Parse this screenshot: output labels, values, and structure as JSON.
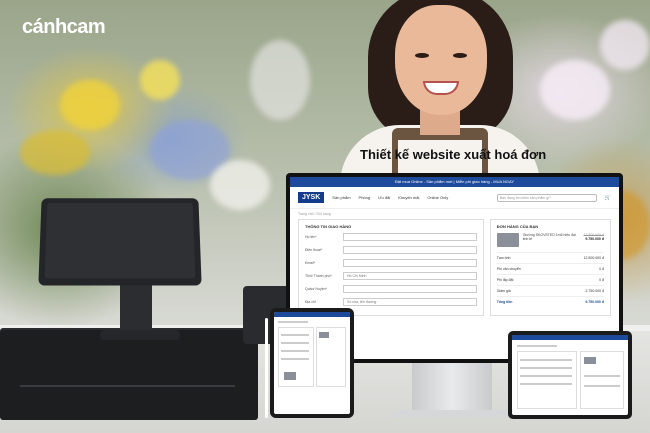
{
  "brand_logo": "cánhcam",
  "headline": "Thiết kế website xuất hoá đơn",
  "monitor": {
    "promo_text": "Đặt mua Online - Sản phẩm mới | Miễn phí giao hàng - MUA NGAY",
    "brand": "JYSK",
    "nav": [
      "Sản phẩm",
      "Phòng",
      "Ưu đãi",
      "Khuyến mãi",
      "Online Only"
    ],
    "search_placeholder": "Bạn đang tìm kiếm sản phẩm gì?",
    "breadcrumb": "Trang chủ / Giỏ hàng",
    "form": {
      "title": "THÔNG TIN GIAO HÀNG",
      "fields": [
        {
          "label": "Họ tên*",
          "value": ""
        },
        {
          "label": "Điện thoại*",
          "value": ""
        },
        {
          "label": "Email*",
          "value": ""
        },
        {
          "label": "Tỉnh/ Thành phố*",
          "value": "Hồ Chí Minh"
        },
        {
          "label": "Quận/ Huyện*",
          "value": ""
        },
        {
          "label": "Địa chỉ",
          "value": "Số nhà, tên đường"
        }
      ]
    },
    "order": {
      "title": "ĐƠN HÀNG CỦA BẠN",
      "product": "Giường SKOVSTED 1m6 hiện đại tinh tế",
      "old_price": "12.500.000 đ",
      "new_price": "9.750.000 đ",
      "rows": [
        {
          "label": "Tạm tính",
          "value": "12.500.000 đ"
        },
        {
          "label": "Phí vận chuyển",
          "value": "0 đ"
        },
        {
          "label": "Phí lắp đặt",
          "value": "0 đ"
        },
        {
          "label": "Giảm giá",
          "value": "-2.750.000 đ"
        },
        {
          "label": "Tổng tiền",
          "value": "9.750.000 đ"
        }
      ]
    }
  },
  "colors": {
    "brand_blue": "#1d4a9a",
    "promo_bar": "#1d4a9a"
  }
}
